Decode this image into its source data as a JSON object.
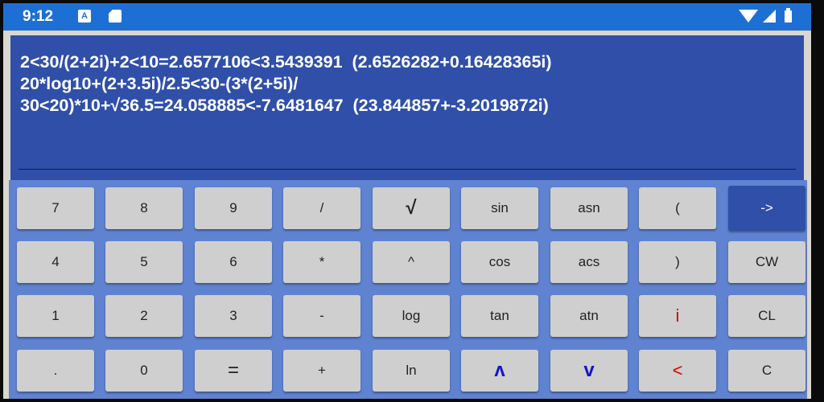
{
  "status_bar": {
    "time": "9:12",
    "icons": [
      "text-a-icon",
      "sd-card-icon",
      "wifi-icon",
      "signal-icon",
      "battery-icon"
    ]
  },
  "display": {
    "lines": [
      "2<30/(2+2i)+2<10=2.6577106<3.5439391  (2.6526282+0.16428365i)",
      "20*log10+(2+3.5i)/2.5<30-(3*(2+5i)/",
      "30<20)*10+√36.5=24.058885<-7.6481647  (23.844857+-3.2019872i)"
    ]
  },
  "colors": {
    "status_bar": "#1e6fd4",
    "display_bg": "#2f4fa8",
    "keypad_bg": "#5f83d1",
    "key_bg": "#cfcfcf",
    "accent_red": "#d60000",
    "accent_blue": "#1414c8"
  },
  "keys": [
    [
      "7",
      "8",
      "9",
      "/",
      "√",
      "sin",
      "asn",
      "(",
      "->"
    ],
    [
      "4",
      "5",
      "6",
      "*",
      "^",
      "cos",
      "acs",
      ")",
      "CW"
    ],
    [
      "1",
      "2",
      "3",
      "-",
      "log",
      "tan",
      "atn",
      "i",
      "CL"
    ],
    [
      ".",
      "0",
      "=",
      "+",
      "ln",
      "ʌ",
      "v",
      "<",
      "C"
    ]
  ]
}
